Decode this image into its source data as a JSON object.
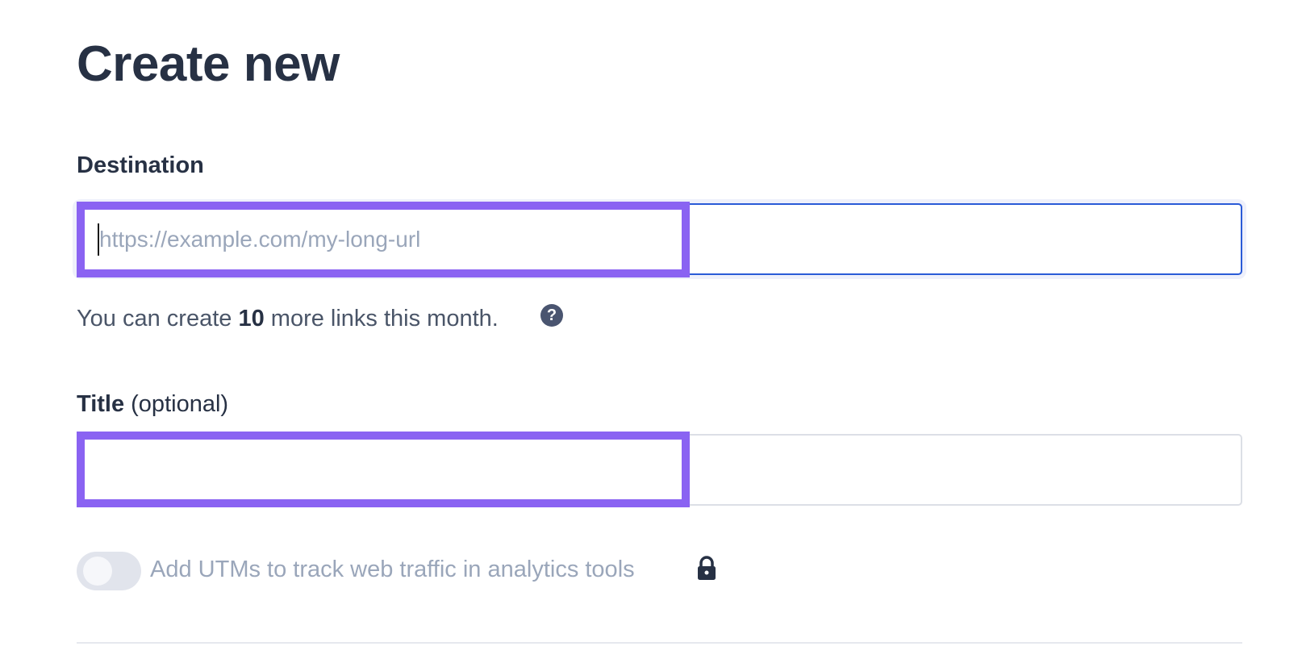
{
  "page": {
    "title": "Create new"
  },
  "destination": {
    "label": "Destination",
    "placeholder": "https://example.com/my-long-url",
    "value": ""
  },
  "quota": {
    "prefix": "You can create ",
    "count": "10",
    "suffix": " more links this month.",
    "help_icon": "question-circle-icon",
    "help_glyph": "?"
  },
  "title_field": {
    "label_bold": "Title",
    "label_optional": " (optional)",
    "value": ""
  },
  "utm": {
    "toggle_on": false,
    "label": "Add UTMs to track web traffic in analytics tools",
    "lock_icon": "lock-icon"
  },
  "colors": {
    "highlight": "#8a63f2",
    "focus_border": "#2a5bd7",
    "text_primary": "#273144",
    "text_muted": "#9aa6ba"
  }
}
